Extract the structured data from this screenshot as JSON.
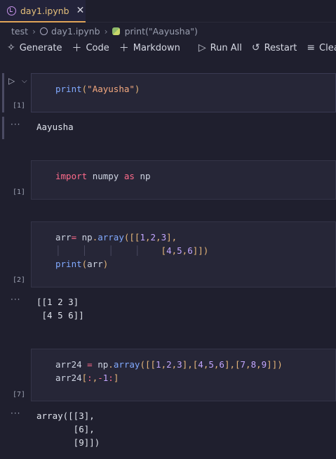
{
  "tab": {
    "label": "day1.ipynb",
    "close": "✕"
  },
  "breadcrumb": {
    "folder": "test",
    "file": "day1.ipynb",
    "cell": "print(\"Aayusha\")"
  },
  "toolbar": {
    "generate": "Generate",
    "code": "Code",
    "markdown": "Markdown",
    "run_all": "Run All",
    "restart": "Restart",
    "clear": "Clear A"
  },
  "cells": [
    {
      "exec": "[1]",
      "output": "Aayusha"
    },
    {
      "exec": "[1]"
    },
    {
      "exec": "[2]",
      "output": "[[1 2 3]\n [4 5 6]]"
    },
    {
      "exec": "[7]",
      "output": "array([[3],\n       [6],\n       [9]])"
    }
  ],
  "out_marker": "···"
}
